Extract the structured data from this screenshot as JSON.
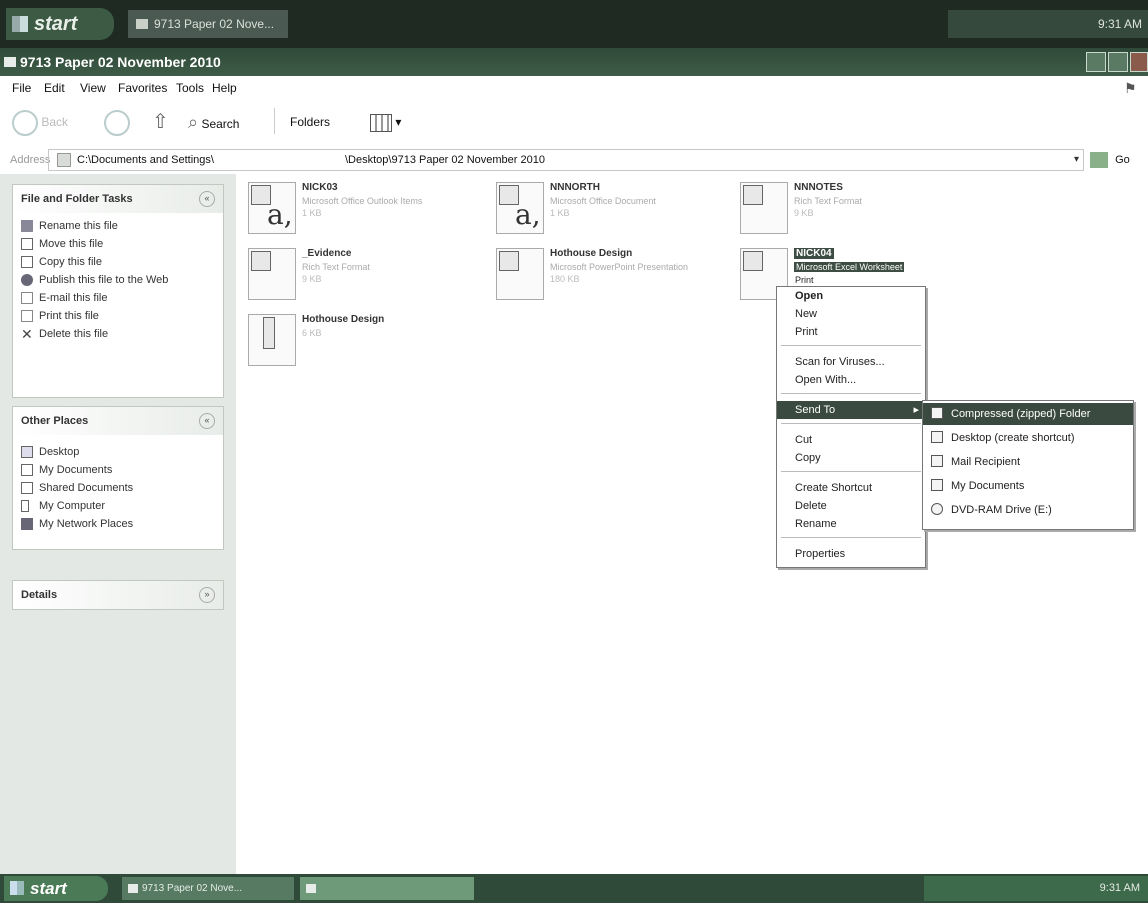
{
  "taskbar_top": {
    "start_label": "start",
    "task_label": "9713 Paper 02 Nove...",
    "tray_time": "9:31 AM"
  },
  "window": {
    "title": "9713 Paper 02 November 2010"
  },
  "menubar": {
    "file": "File",
    "edit": "Edit",
    "view": "View",
    "favorites": "Favorites",
    "tools": "Tools",
    "help": "Help"
  },
  "toolbar": {
    "back": "Back",
    "search": "Search",
    "folders": "Folders"
  },
  "addressbar": {
    "label": "Address",
    "path_left": "C:\\Documents and Settings\\",
    "path_right": "\\Desktop\\9713 Paper 02 November 2010",
    "go": "Go"
  },
  "left_panel": {
    "file_tasks": {
      "title": "File and Folder Tasks",
      "items": [
        "Rename this file",
        "Move this file",
        "Copy this file",
        "Publish this file to the Web",
        "E-mail this file",
        "Print this file",
        "Delete this file"
      ]
    },
    "other_places": {
      "title": "Other Places",
      "items": [
        "Desktop",
        "My Documents",
        "Shared Documents",
        "My Computer",
        "My Network Places"
      ]
    },
    "details": {
      "title": "Details"
    }
  },
  "files": [
    {
      "name": "NICK03",
      "sub": "Microsoft Office Outlook Items",
      "size": "1 KB",
      "kind": "text"
    },
    {
      "name": "NNNORTH",
      "sub": "Microsoft Office Document",
      "size": "1 KB",
      "kind": "text"
    },
    {
      "name": "NNNOTES",
      "sub": "Rich Text Format",
      "size": "9 KB",
      "kind": "doc"
    },
    {
      "name": "_Evidence",
      "sub": "Rich Text Format",
      "size": "9 KB",
      "kind": "doc"
    },
    {
      "name": "Hothouse Design",
      "sub": "Microsoft PowerPoint Presentation",
      "size": "180 KB",
      "kind": "doc"
    },
    {
      "name": "NICK04",
      "sub": "Microsoft Excel Worksheet",
      "size": "",
      "kind": "xls",
      "selected": true
    },
    {
      "name": "Hothouse Design",
      "sub": "",
      "size": "6 KB",
      "kind": "exe"
    }
  ],
  "context_menu": {
    "items": [
      "Print",
      "Open",
      "New",
      "Print",
      "Scan for Viruses...",
      "Open With...",
      "Send To",
      "Cut",
      "Copy",
      "Create Shortcut",
      "Delete",
      "Rename",
      "Properties"
    ]
  },
  "send_to_menu": {
    "items": [
      "Compressed (zipped) Folder",
      "Desktop (create shortcut)",
      "Mail Recipient",
      "My Documents",
      "DVD-RAM Drive (E:)"
    ]
  },
  "taskbar_bottom": {
    "start_label": "start",
    "task_1": "9713 Paper 02 Nove...",
    "task_2": "",
    "tray_time": "9:31 AM"
  },
  "colors": {
    "title_bar": "#2f4a38",
    "highlight": "#3a4a40",
    "left_panel_bg": "#e4e8e4"
  }
}
